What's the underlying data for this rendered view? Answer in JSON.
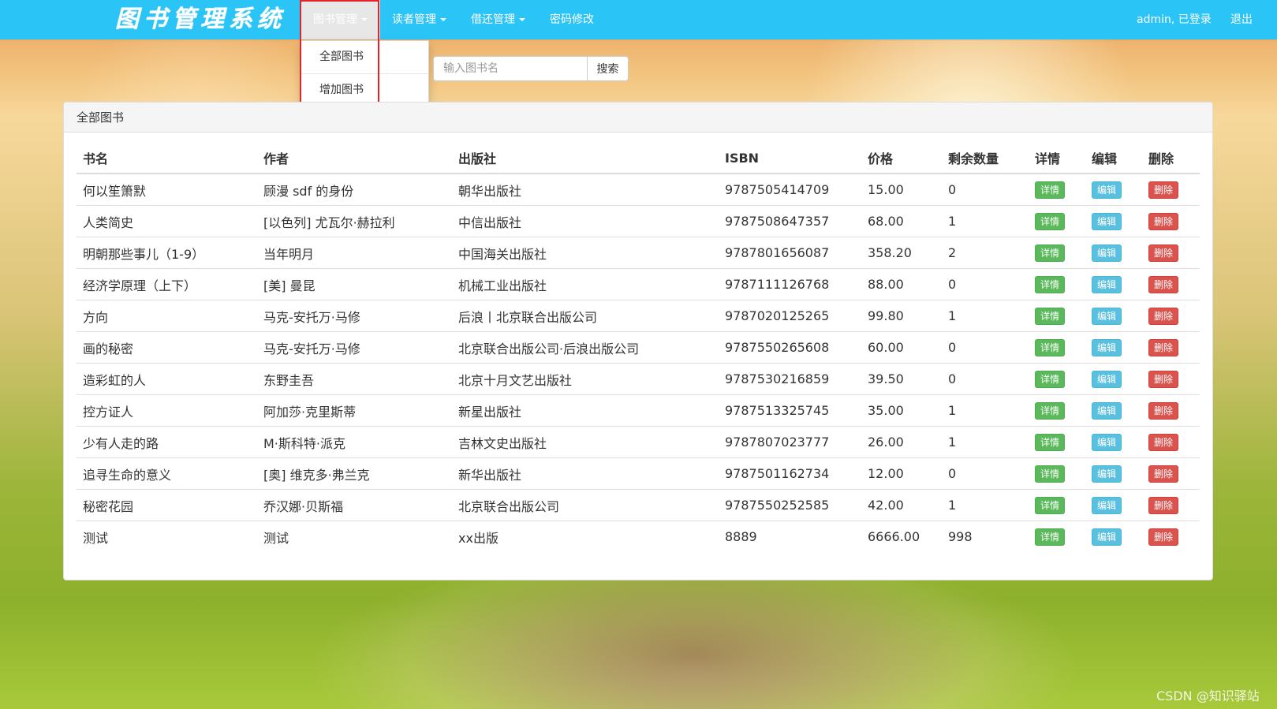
{
  "app": {
    "title": "图书管理系统"
  },
  "nav": {
    "items": [
      {
        "label": "图书管理",
        "has_caret": true,
        "active": true
      },
      {
        "label": "读者管理",
        "has_caret": true
      },
      {
        "label": "借还管理",
        "has_caret": true
      },
      {
        "label": "密码修改",
        "has_caret": false
      }
    ],
    "user_status": "admin, 已登录",
    "logout": "退出"
  },
  "dropdown": {
    "items": [
      "全部图书",
      "增加图书"
    ]
  },
  "search": {
    "placeholder": "输入图书名",
    "value": "",
    "button": "搜索"
  },
  "panel": {
    "title": "全部图书"
  },
  "table": {
    "headers": [
      "书名",
      "作者",
      "出版社",
      "ISBN",
      "价格",
      "剩余数量",
      "详情",
      "编辑",
      "删除"
    ],
    "actions": {
      "detail": "详情",
      "edit": "编辑",
      "delete": "删除"
    },
    "rows": [
      [
        "何以笙箫默",
        "顾漫 sdf 的身份",
        "朝华出版社",
        "9787505414709",
        "15.00",
        "0"
      ],
      [
        "人类简史",
        "[以色列] 尤瓦尔·赫拉利",
        "中信出版社",
        "9787508647357",
        "68.00",
        "1"
      ],
      [
        "明朝那些事儿（1-9）",
        "当年明月",
        "中国海关出版社",
        "9787801656087",
        "358.20",
        "2"
      ],
      [
        "经济学原理（上下）",
        "[美] 曼昆",
        "机械工业出版社",
        "9787111126768",
        "88.00",
        "0"
      ],
      [
        "方向",
        "马克-安托万·马修",
        "后浪丨北京联合出版公司",
        "9787020125265",
        "99.80",
        "1"
      ],
      [
        "画的秘密",
        "马克-安托万·马修",
        "北京联合出版公司·后浪出版公司",
        "9787550265608",
        "60.00",
        "0"
      ],
      [
        "造彩虹的人",
        "东野圭吾",
        "北京十月文艺出版社",
        "9787530216859",
        "39.50",
        "0"
      ],
      [
        "控方证人",
        "阿加莎·克里斯蒂",
        "新星出版社",
        "9787513325745",
        "35.00",
        "1"
      ],
      [
        "少有人走的路",
        "M·斯科特·派克",
        "吉林文史出版社",
        "9787807023777",
        "26.00",
        "1"
      ],
      [
        "追寻生命的意义",
        "[奥] 维克多·弗兰克",
        "新华出版社",
        "9787501162734",
        "12.00",
        "0"
      ],
      [
        "秘密花园",
        "乔汉娜·贝斯福",
        "北京联合出版公司",
        "9787550252585",
        "42.00",
        "1"
      ],
      [
        "测试",
        "测试",
        "xx出版",
        "8889",
        "6666.00",
        "998"
      ]
    ]
  },
  "watermark": "CSDN @知识驿站",
  "colors": {
    "navbar": "#2bc4f7",
    "success": "#5cb85c",
    "info": "#5bc0de",
    "danger": "#d9534f",
    "highlight": "#e5232a"
  }
}
